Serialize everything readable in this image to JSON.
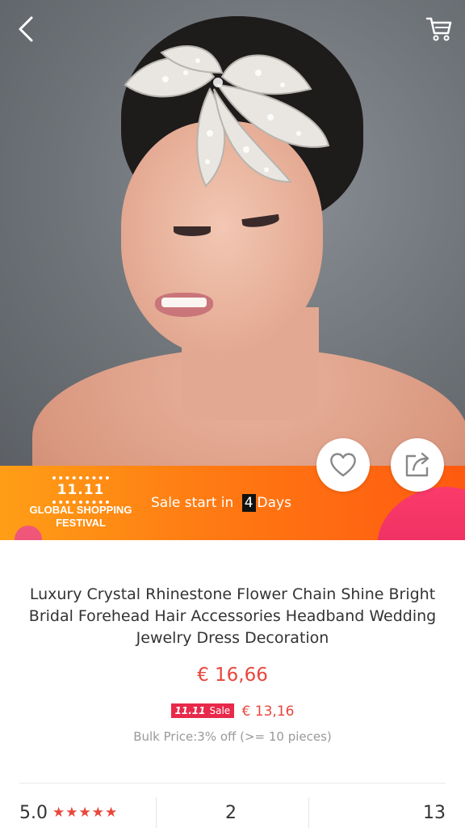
{
  "header": {
    "back_icon": "chevron-left-icon",
    "cart_icon": "shopping-cart-icon"
  },
  "product_image": {
    "description_icon": "product-photo"
  },
  "actions": {
    "wishlist_icon": "heart-icon",
    "share_icon": "share-icon"
  },
  "festival": {
    "logo_mark": "11.11",
    "logo_line1": "GLOBAL SHOPPING",
    "logo_line2": "FESTIVAL",
    "sale_prefix": "Sale start in",
    "days_number": "4",
    "days_suffix": "Days"
  },
  "product": {
    "title": "Luxury Crystal Rhinestone Flower Chain Shine Bright Bridal  Forehead Hair Accessories Headband Wedding Jewelry Dress Decoration",
    "price": "€ 16,66",
    "sale_badge_mark": "11.11",
    "sale_badge_label": "Sale",
    "sale_price": "€ 13,16",
    "bulk_price": "Bulk Price:3% off (>= 10 pieces)"
  },
  "stats": {
    "rating": "5.0",
    "stars": "★★★★★",
    "stars_count": 5,
    "orders": "2",
    "wishlist": "13"
  },
  "colors": {
    "accent": "#e8463c",
    "festival_orange": "#ff7a13",
    "sale_badge": "#e8294a"
  }
}
